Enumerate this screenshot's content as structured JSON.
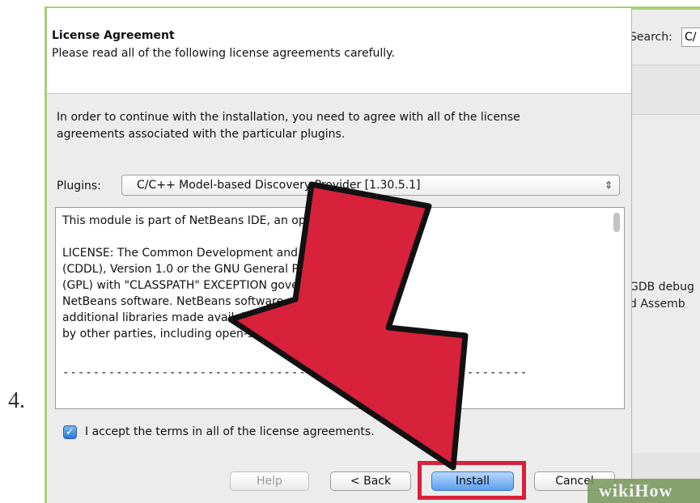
{
  "step": {
    "number": "4."
  },
  "background_window": {
    "search_label": "Search: ",
    "search_value": "C/",
    "side_text_line1": "GDB debug",
    "side_text_line2": "d Assemb"
  },
  "dialog": {
    "header_title": "License Agreement",
    "header_subtitle": "Please read all of the following license agreements carefully.",
    "instruction": "In order to continue with the installation, you need to agree with all of the license agreements associated with the particular plugins.",
    "plugins_label": "Plugins:",
    "plugins_selected": "C/C++ Model-based Discovery Provider [1.30.5.1]",
    "license_lines": [
      "This module is part of NetBeans IDE, an open-source",
      "",
      "LICENSE: The Common Development and Distribution License",
      "(CDDL), Version 1.0 or the GNU General Public License",
      "(GPL) with \"CLASSPATH\" EXCEPTION governing the",
      "NetBeans software. NetBeans software consists of",
      "additional libraries made available under a license option",
      "by other parties, including open-source"
    ],
    "license_separator": "-------------------------------------------------------------",
    "accept_label": "I accept the terms in all of the license agreements.",
    "accept_checked": true,
    "buttons": {
      "help": "Help",
      "back": "< Back",
      "install": "Install",
      "cancel": "Cancel"
    }
  },
  "overlay": {
    "arrow_color": "#d8213a",
    "highlight_color": "#d8213a"
  },
  "watermark": {
    "text": "wikiHow"
  }
}
